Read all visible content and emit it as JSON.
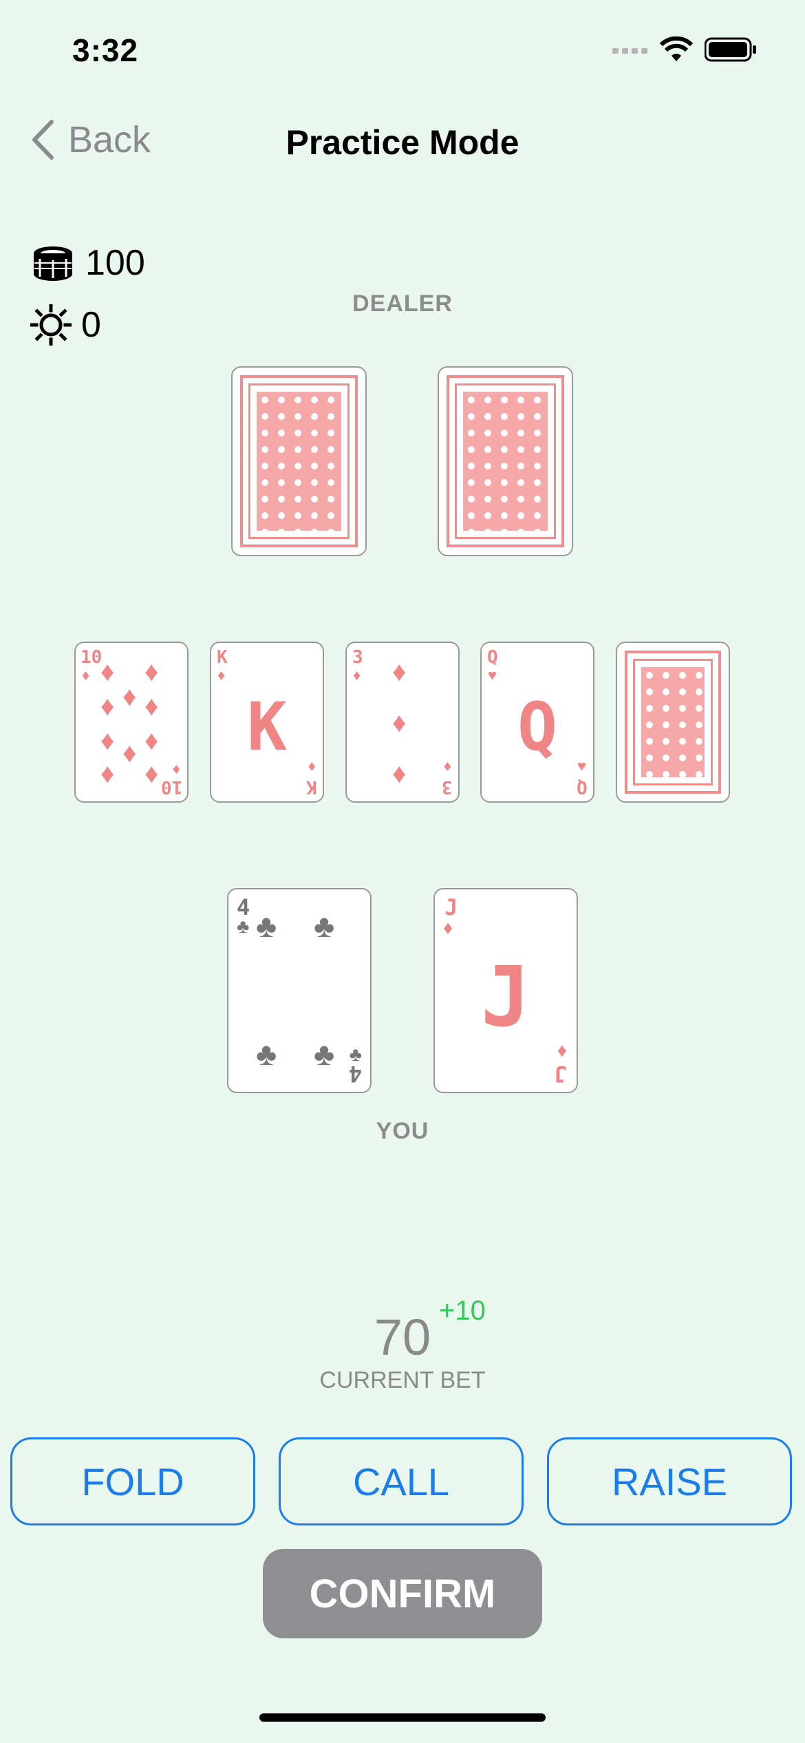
{
  "status": {
    "time": "3:32"
  },
  "nav": {
    "back_label": "Back",
    "title": "Practice Mode"
  },
  "stats": {
    "coins": "100",
    "coins_icon": "chips-icon",
    "sun": "0",
    "sun_icon": "sun-icon"
  },
  "dealer": {
    "label": "DEALER",
    "cards": [
      "face-down",
      "face-down"
    ]
  },
  "community": {
    "cards": [
      {
        "rank": "10",
        "suit": "♦",
        "color": "red"
      },
      {
        "rank": "K",
        "suit": "♦",
        "color": "red"
      },
      {
        "rank": "3",
        "suit": "♦",
        "color": "red"
      },
      {
        "rank": "Q",
        "suit": "♥",
        "color": "red"
      },
      {
        "rank": "",
        "suit": "",
        "color": "face-down"
      }
    ]
  },
  "player": {
    "label": "YOU",
    "cards": [
      {
        "rank": "4",
        "suit": "♣",
        "color": "dark"
      },
      {
        "rank": "J",
        "suit": "♦",
        "color": "red"
      }
    ]
  },
  "bet": {
    "value": "70",
    "delta": "+10",
    "label": "CURRENT BET"
  },
  "actions": {
    "fold": "FOLD",
    "call": "CALL",
    "raise": "RAISE",
    "confirm": "CONFIRM"
  },
  "colors": {
    "background": "#EAF7EE",
    "accent": "#1A7DEB",
    "card_red": "#F08585",
    "delta_green": "#34C759",
    "confirm_gray": "#8E8E93"
  }
}
